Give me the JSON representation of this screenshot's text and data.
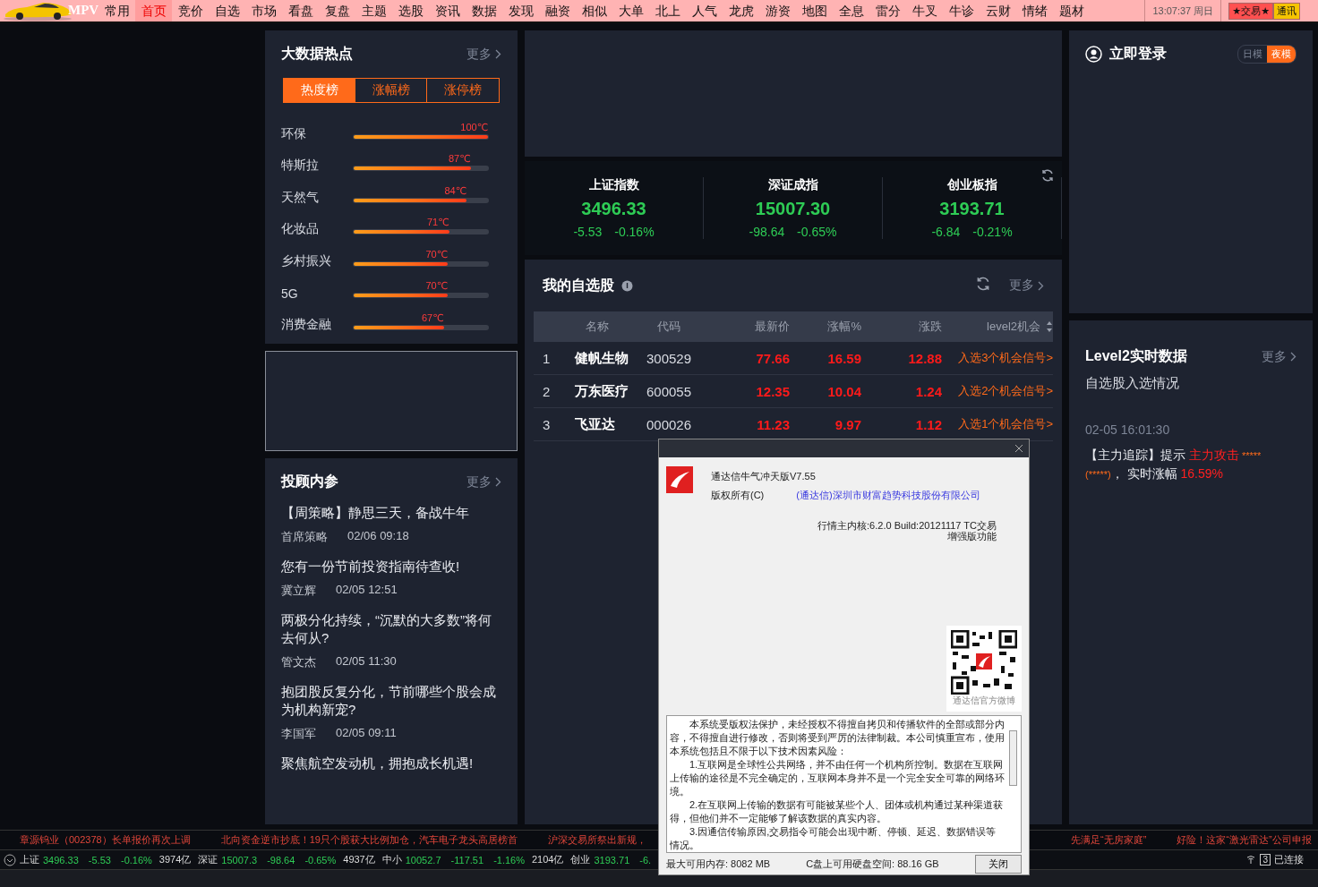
{
  "menu": {
    "logo": "MPV",
    "items": [
      {
        "label": "常用",
        "selected": false
      },
      {
        "label": "首页",
        "selected": true
      },
      {
        "label": "竞价",
        "selected": false
      },
      {
        "label": "自选",
        "selected": false
      },
      {
        "label": "市场",
        "selected": false
      },
      {
        "label": "看盘",
        "selected": false
      },
      {
        "label": "复盘",
        "selected": false
      },
      {
        "label": "主题",
        "selected": false
      },
      {
        "label": "选股",
        "selected": false
      },
      {
        "label": "资讯",
        "selected": false
      },
      {
        "label": "数据",
        "selected": false
      },
      {
        "label": "发现",
        "selected": false
      },
      {
        "label": "融资",
        "selected": false
      },
      {
        "label": "相似",
        "selected": false
      },
      {
        "label": "大单",
        "selected": false
      },
      {
        "label": "北上",
        "selected": false
      },
      {
        "label": "人气",
        "selected": false
      },
      {
        "label": "龙虎",
        "selected": false
      },
      {
        "label": "游资",
        "selected": false
      },
      {
        "label": "地图",
        "selected": false
      },
      {
        "label": "全息",
        "selected": false
      },
      {
        "label": "雷分",
        "selected": false
      },
      {
        "label": "牛叉",
        "selected": false
      },
      {
        "label": "牛诊",
        "selected": false
      },
      {
        "label": "云财",
        "selected": false
      },
      {
        "label": "情绪",
        "selected": false
      },
      {
        "label": "题材",
        "selected": false
      }
    ],
    "clock": "13:07:37 周日",
    "buttons": [
      "★交易★",
      "通讯"
    ]
  },
  "hot": {
    "title": "大数据热点",
    "more": "更多",
    "tabs": [
      {
        "label": "热度榜",
        "selected": true
      },
      {
        "label": "涨幅榜",
        "selected": false
      },
      {
        "label": "涨停榜",
        "selected": false
      }
    ],
    "items": [
      {
        "name": "环保",
        "level": 1.0,
        "reading": "100℃"
      },
      {
        "name": "特斯拉",
        "level": 0.87,
        "reading": "87℃"
      },
      {
        "name": "天然气",
        "level": 0.84,
        "reading": "84℃"
      },
      {
        "name": "化妆品",
        "level": 0.71,
        "reading": "71℃"
      },
      {
        "name": "乡村振兴",
        "level": 0.7,
        "reading": "70℃"
      },
      {
        "name": "5G",
        "level": 0.7,
        "reading": "70℃"
      },
      {
        "name": "消费金融",
        "level": 0.67,
        "reading": "67℃"
      }
    ]
  },
  "advisor": {
    "title": "投顾内参",
    "more": "更多",
    "articles": [
      {
        "title": "【周策略】静思三天，备战牛年",
        "author": "首席策略",
        "time": "02/06 09:18"
      },
      {
        "title": "您有一份节前投资指南待查收!",
        "author": "冀立辉",
        "time": "02/05 12:51"
      },
      {
        "title": "两极分化持续，“沉默的大多数”将何去何从?",
        "author": "管文杰",
        "time": "02/05 11:30"
      },
      {
        "title": "抱团股反复分化，节前哪些个股会成为机构新宠?",
        "author": "李国军",
        "time": "02/05 09:11"
      },
      {
        "title": "聚焦航空发动机，拥抱成长机遇!"
      }
    ]
  },
  "indices": [
    {
      "name": "上证指数",
      "value": "3496.33",
      "change": "-5.53",
      "pct": "-0.16%"
    },
    {
      "name": "深证成指",
      "value": "15007.30",
      "change": "-98.64",
      "pct": "-0.65%"
    },
    {
      "name": "创业板指",
      "value": "3193.71",
      "change": "-6.84",
      "pct": "-0.21%"
    }
  ],
  "watchlist": {
    "title": "我的自选股",
    "more": "更多",
    "columns": [
      "名称",
      "代码",
      "最新价",
      "涨幅%",
      "涨跌",
      "level2机会"
    ],
    "rows": [
      {
        "index": "1",
        "name": "健帆生物",
        "code": "300529",
        "price": "77.66",
        "pct": "16.59",
        "change": "12.88",
        "signal": "入选3个机会信号>"
      },
      {
        "index": "2",
        "name": "万东医疗",
        "code": "600055",
        "price": "12.35",
        "pct": "10.04",
        "change": "1.24",
        "signal": "入选2个机会信号>"
      },
      {
        "index": "3",
        "name": "飞亚达",
        "code": "000026",
        "price": "11.23",
        "pct": "9.97",
        "change": "1.12",
        "signal": "入选1个机会信号>"
      }
    ]
  },
  "account": {
    "login": "立即登录",
    "modes": [
      {
        "label": "日模",
        "selected": false
      },
      {
        "label": "夜模",
        "selected": true
      }
    ]
  },
  "level2": {
    "title": "Level2实时数据",
    "more": "更多",
    "subtitle": "自选股入选情况",
    "time": "02-05 16:01:30",
    "message": [
      {
        "kind": "plain",
        "text": "【主力追踪】提示 "
      },
      {
        "kind": "alert",
        "text": "主力攻击"
      },
      {
        "kind": "stars",
        "text": " *****(*****)"
      },
      {
        "kind": "plain",
        "text": "， 实时涨幅 "
      },
      {
        "kind": "alert",
        "text": "16.59%"
      }
    ]
  },
  "ticker": [
    "章源钨业（002378）长单报价再次上调",
    "北向资金逆市抄底！19只个股获大比例加仓，汽车电子龙头高居榜首",
    "沪深交易所祭出新规，",
    "先满足“无房家庭”",
    "好险！这家“激光雷达”公司申报"
  ],
  "status": {
    "quotes": [
      {
        "name": "上证",
        "value": "3496.33",
        "change": "-5.53",
        "pct": "-0.16%",
        "amount": "3974亿"
      },
      {
        "name": "深证",
        "value": "15007.3",
        "change": "-98.64",
        "pct": "-0.65%",
        "amount": "4937亿"
      },
      {
        "name": "中小",
        "value": "10052.7",
        "change": "-117.51",
        "pct": "-1.16%",
        "amount": "2104亿"
      },
      {
        "name": "创业",
        "value": "3193.71",
        "change": "-6."
      }
    ],
    "channel": "3",
    "connection": "已连接"
  },
  "about": {
    "product": "通达信牛气冲天版V7.55",
    "copyright": "版权所有(C)",
    "company": "(通达信)深圳市财富趋势科技股份有限公司",
    "build": [
      "行情主内核:6.2.0 Build:20121117 TC交易",
      "增强版功能"
    ],
    "qr_caption": "通达信官方微博",
    "license": [
      "本系统受版权法保护，未经授权不得擅自拷贝和传播软件的全部或部分内容，不得擅自进行修改，否则将受到严厉的法律制裁。本公司慎重宣布，使用本系统包括且不限于以下技术因素风险：",
      "1.互联网是全球性公共网络，并不由任何一个机构所控制。数据在互联网上传输的途径是不完全确定的，互联网本身并不是一个完全安全可靠的网络环境。",
      "2.在互联网上传输的数据有可能被某些个人、团体或机构通过某种渠道获得，但他们并不一定能够了解该数据的真实内容。",
      "3.因通信传输原因,交易指令可能会出现中断、停顿、延迟、数据错误等情况。"
    ],
    "memory": "最大可用内存: 8082 MB",
    "disk": "C盘上可用硬盘空间: 88.16 GB",
    "close": "关闭"
  }
}
